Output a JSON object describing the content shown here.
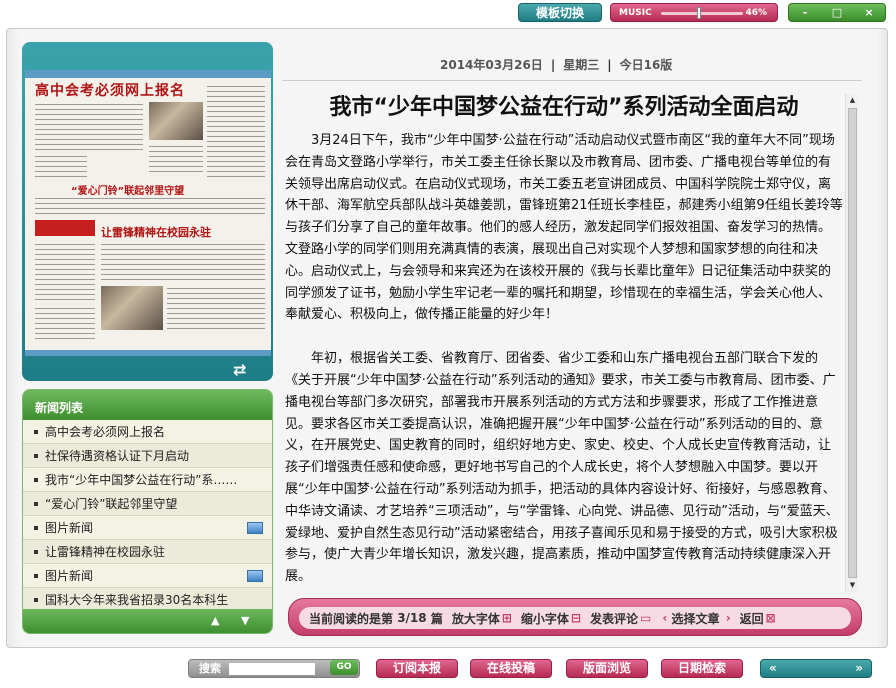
{
  "topbar": {
    "template_switch": "模板切换",
    "music_label": "MUSIC",
    "music_volume": 46,
    "music_volume_text": "46%",
    "minimize": "-",
    "maximize": "□",
    "close": "×"
  },
  "paper": {
    "headline": "高中会考必须网上报名",
    "subhead": "“爱心门铃”联起邻里守望",
    "subhead2": "让雷锋精神在校园永驻"
  },
  "news_list": {
    "title": "新闻列表",
    "items": [
      {
        "label": "高中会考必须网上报名",
        "has_picture": false
      },
      {
        "label": "社保待遇资格认证下月启动",
        "has_picture": false
      },
      {
        "label": "我市“少年中国梦公益在行动”系……",
        "has_picture": false
      },
      {
        "label": "“爱心门铃”联起邻里守望",
        "has_picture": false
      },
      {
        "label": "图片新闻",
        "has_picture": true
      },
      {
        "label": "让雷锋精神在校园永驻",
        "has_picture": false
      },
      {
        "label": "图片新闻",
        "has_picture": true
      },
      {
        "label": "国科大今年来我省招录30名本科生",
        "has_picture": false
      }
    ]
  },
  "article": {
    "date": "2014年03月26日",
    "weekday": "星期三",
    "edition": "今日16版",
    "title": "我市“少年中国梦公益在行动”系列活动全面启动",
    "paragraphs": [
      "3月24日下午，我市“少年中国梦·公益在行动”活动启动仪式暨市南区“我的童年大不同”现场会在青岛文登路小学举行，市关工委主任徐长聚以及市教育局、团市委、广播电视台等单位的有关领导出席启动仪式。在启动仪式现场，市关工委五老宣讲团成员、中国科学院院士郑守仪，离休干部、海军航空兵部队战斗英雄姜凯，雷锋班第21任班长李桂臣，郝建秀小组第9任组长姜玲等与孩子们分享了自己的童年故事。他们的感人经历，激发起同学们报效祖国、奋发学习的热情。文登路小学的同学们则用充满真情的表演，展现出自己对实现个人梦想和国家梦想的向往和决心。启动仪式上，与会领导和来宾还为在该校开展的《我与长辈比童年》日记征集活动中获奖的同学颁发了证书，勉励小学生牢记老一辈的嘱托和期望，珍惜现在的幸福生活，学会关心他人、奉献爱心、积极向上，做传播正能量的好少年！",
      "年初，根据省关工委、省教育厅、团省委、省少工委和山东广播电视台五部门联合下发的《关于开展“少年中国梦·公益在行动”系列活动的通知》要求，市关工委与市教育局、团市委、广播电视台等部门多次研究，部署我市开展系列活动的方式方法和步骤要求，形成了工作推进意见。要求各区市关工委提高认识，准确把握开展“少年中国梦·公益在行动”系列活动的目的、意义，在开展党史、国史教育的同时，组织好地方史、家史、校史、个人成长史宣传教育活动，让孩子们增强责任感和使命感，更好地书写自己的个人成长史，将个人梦想融入中国梦。要以开展“少年中国梦·公益在行动”系列活动为抓手，把活动的具体内容设计好、衔接好，与感恩教育、中华诗文诵读、才艺培养“三项活动”，与“学雷锋、心向党、讲品德、见行动”活动，与“爱蓝天、爱绿地、爱护自然生态见行动”活动紧密结合，用孩子喜闻乐见和易于接受的方式，吸引大家积极参与，使广大青少年增长知识，激发兴趣，提高素质，推动中国梦宣传教育活动持续健康深入开展。"
    ]
  },
  "reading_bar": {
    "current_label": "当前阅读的是第",
    "page": "3/18",
    "unit": "篇",
    "zoom_in": "放大字体",
    "zoom_out": "缩小字体",
    "comment": "发表评论",
    "select": "选择文章",
    "back": "返回"
  },
  "bottombar": {
    "search_label": "搜索",
    "go": "GO",
    "subscribe": "订阅本报",
    "submit": "在线投稿",
    "browse": "版面浏览",
    "date_search": "日期检索",
    "prev": "«",
    "next": "»"
  },
  "colors": {
    "teal": "#1f7d83",
    "pink": "#c23d69",
    "green": "#3d8f2f"
  }
}
